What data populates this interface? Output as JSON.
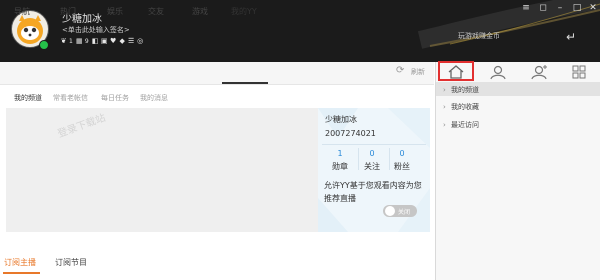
{
  "header": {
    "username": "少糖加冰",
    "signature": "<单击此处输入签名>",
    "badges": [
      {
        "icon": "flag-badge-icon",
        "glyph": "❦",
        "count": "1"
      },
      {
        "icon": "gift-badge-icon",
        "glyph": "▦",
        "count": "9"
      },
      {
        "icon": "level-badge-icon",
        "glyph": "◧",
        "count": ""
      },
      {
        "icon": "vip-badge-icon",
        "glyph": "▣",
        "count": ""
      },
      {
        "icon": "heart-badge-icon",
        "glyph": "♥",
        "count": ""
      },
      {
        "icon": "diamond-badge-icon",
        "glyph": "◆",
        "count": ""
      },
      {
        "icon": "coins-badge-icon",
        "glyph": "☰",
        "count": ""
      },
      {
        "icon": "target-badge-icon",
        "glyph": "◎",
        "count": ""
      }
    ],
    "earn_link": "玩游戏赚金币"
  },
  "tabs": [
    "导航",
    "热门",
    "娱乐",
    "交友",
    "游戏",
    "我的YY"
  ],
  "active_tab": "我的YY",
  "refresh_label": "刷新",
  "subtabs": [
    "我的频道",
    "常看老帐信",
    "每日任务",
    "我的消息"
  ],
  "active_subtab": "我的频道",
  "video": {
    "watermark": "登录下载站"
  },
  "card": {
    "name": "少糖加冰",
    "id": "2007274021",
    "stats": [
      {
        "num": "1",
        "label": "勋章"
      },
      {
        "num": "0",
        "label": "关注"
      },
      {
        "num": "0",
        "label": "粉丝"
      }
    ],
    "recommend_text": "允许YY基于您观看内容为您推荐直播",
    "toggle_label": "关闭"
  },
  "bottom_tabs": [
    "订阅主播",
    "订阅节目"
  ],
  "active_bottom_tab": "订阅主播",
  "right_panel": {
    "icons": [
      "home-icon",
      "user-icon",
      "contacts-icon",
      "apps-icon"
    ],
    "items": [
      "我的频道",
      "我的收藏",
      "最近访问"
    ],
    "selected_item": "我的频道"
  },
  "colors": {
    "accent": "#e8782a",
    "link": "#2a8ad8",
    "header_bg": "#1b1b1b",
    "highlight": "#e23030"
  }
}
